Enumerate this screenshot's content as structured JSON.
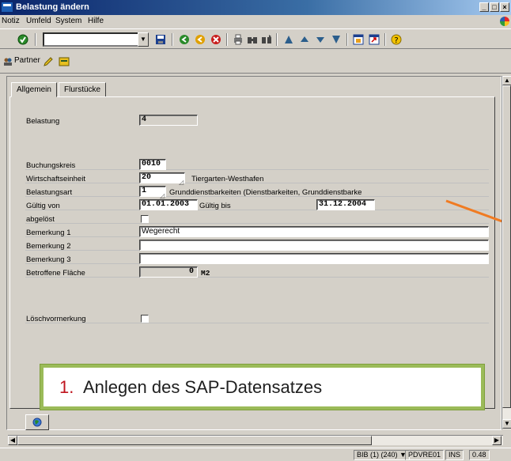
{
  "window": {
    "title": "Belastung ändern"
  },
  "menubar": {
    "items": [
      "Notiz",
      "Umfeld",
      "System",
      "Hilfe"
    ]
  },
  "toolbar": {
    "command_value": "",
    "icons": [
      "enter-icon",
      "save-icon",
      "back-icon",
      "exit-icon",
      "cancel-icon",
      "print-icon",
      "find-icon",
      "find-next-icon",
      "first-page-icon",
      "prev-page-icon",
      "next-page-icon",
      "last-page-icon",
      "new-session-icon",
      "shortcut-icon",
      "help-icon"
    ]
  },
  "app_toolbar": {
    "partner_label": "Partner"
  },
  "tabs": [
    {
      "label": "Allgemein",
      "active": true
    },
    {
      "label": "Flurstücke",
      "active": false
    }
  ],
  "form": {
    "belastung": {
      "label": "Belastung",
      "value": "4"
    },
    "buchungskreis": {
      "label": "Buchungskreis",
      "value": "0010"
    },
    "wirtschaftseinheit": {
      "label": "Wirtschaftseinheit",
      "value": "20",
      "text": "Tiergarten-Westhafen"
    },
    "belastungsart": {
      "label": "Belastungsart",
      "value": "1",
      "text": "Grunddienstbarkeiten (Dienstbarkeiten, Grunddienstbarke"
    },
    "gueltig_von": {
      "label": "Gültig von",
      "value": "01.01.2003"
    },
    "gueltig_bis": {
      "label": "Gültig bis",
      "value": "31.12.2004"
    },
    "abgeloest": {
      "label": "abgelöst",
      "checked": false
    },
    "bemerkung1": {
      "label": "Bemerkung 1",
      "value": "Wegerecht"
    },
    "bemerkung2": {
      "label": "Bemerkung 2",
      "value": ""
    },
    "bemerkung3": {
      "label": "Bemerkung 3",
      "value": ""
    },
    "betroffene_flaeche": {
      "label": "Betroffene Fläche",
      "value": "0",
      "unit": "M2"
    },
    "loeschvormerkung": {
      "label": "Löschvormerkung",
      "checked": false
    }
  },
  "callout": {
    "number": "1.",
    "text": "Anlegen des SAP-Datensatzes"
  },
  "statusbar": {
    "system": "BIB (1) (240)",
    "server": "PDVRE01",
    "mode": "INS",
    "time": "0.48"
  },
  "colors": {
    "title_start": "#0a246a",
    "callout_border": "#9bbb59",
    "callout_number": "#c0141e",
    "arrow": "#f07b22"
  }
}
